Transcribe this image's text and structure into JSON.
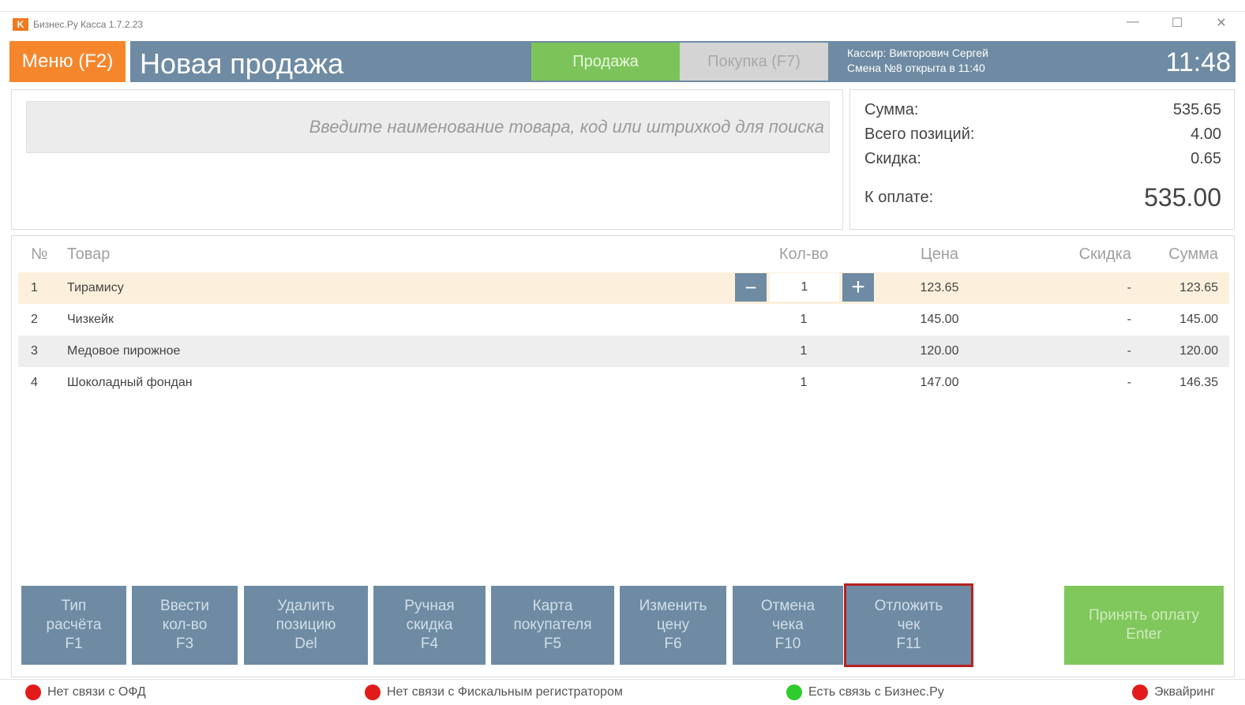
{
  "window": {
    "title": "Бизнес.Ру Касса 1.7.2.23",
    "logo_letter": "K",
    "controls": {
      "minimize": "—",
      "maximize": "☐",
      "close": "✕"
    }
  },
  "header": {
    "menu_label": "Меню (F2)",
    "title": "Новая продажа",
    "mode_sale": "Продажа",
    "mode_purchase": "Покупка (F7)",
    "cashier": "Кассир: Викторович Сергей",
    "shift": "Смена №8 открыта в 11:40",
    "time": "11:48"
  },
  "search": {
    "placeholder": "Введите наименование товара, код или штрихкод для поиска"
  },
  "summary": {
    "sum_label": "Сумма:",
    "sum_value": "535.65",
    "positions_label": "Всего позиций:",
    "positions_value": "4.00",
    "discount_label": "Скидка:",
    "discount_value": "0.65",
    "to_pay_label": "К оплате:",
    "to_pay_value": "535.00"
  },
  "table": {
    "headers": {
      "num": "№",
      "name": "Товар",
      "qty": "Кол-во",
      "price": "Цена",
      "discount": "Скидка",
      "sum": "Сумма"
    },
    "qty_minus": "−",
    "qty_plus": "+",
    "rows": [
      {
        "num": "1",
        "name": "Тирамису",
        "qty": "1",
        "price": "123.65",
        "discount": "-",
        "sum": "123.65"
      },
      {
        "num": "2",
        "name": "Чизкейк",
        "qty": "1",
        "price": "145.00",
        "discount": "-",
        "sum": "145.00"
      },
      {
        "num": "3",
        "name": "Медовое пирожное",
        "qty": "1",
        "price": "120.00",
        "discount": "-",
        "sum": "120.00"
      },
      {
        "num": "4",
        "name": "Шоколадный фондан",
        "qty": "1",
        "price": "147.00",
        "discount": "-",
        "sum": "146.35"
      }
    ]
  },
  "buttons": {
    "payment_type": "Тип\nрасчёта\nF1",
    "enter_qty": "Ввести\nкол-во\nF3",
    "delete_position": "Удалить\nпозицию\nDel",
    "manual_discount": "Ручная\nскидка\nF4",
    "customer_card": "Карта\nпокупателя\nF5",
    "change_price": "Изменить\nцену\nF6",
    "cancel_receipt": "Отмена\nчека\nF10",
    "postpone_receipt": "Отложить\nчек\nF11",
    "accept_payment": "Принять оплату\nEnter"
  },
  "status": {
    "ofd": "Нет связи с ОФД",
    "fiscal": "Нет связи с Фискальным регистратором",
    "bizru": "Есть связь с Бизнес.Ру",
    "acquiring": "Эквайринг"
  },
  "colors": {
    "accent_orange": "#f6862c",
    "header_blue": "#6e8ba3",
    "sale_green": "#7cc45a",
    "status_error": "#e21a1a",
    "status_ok": "#2ecc2e",
    "highlight_red": "#b52222"
  }
}
